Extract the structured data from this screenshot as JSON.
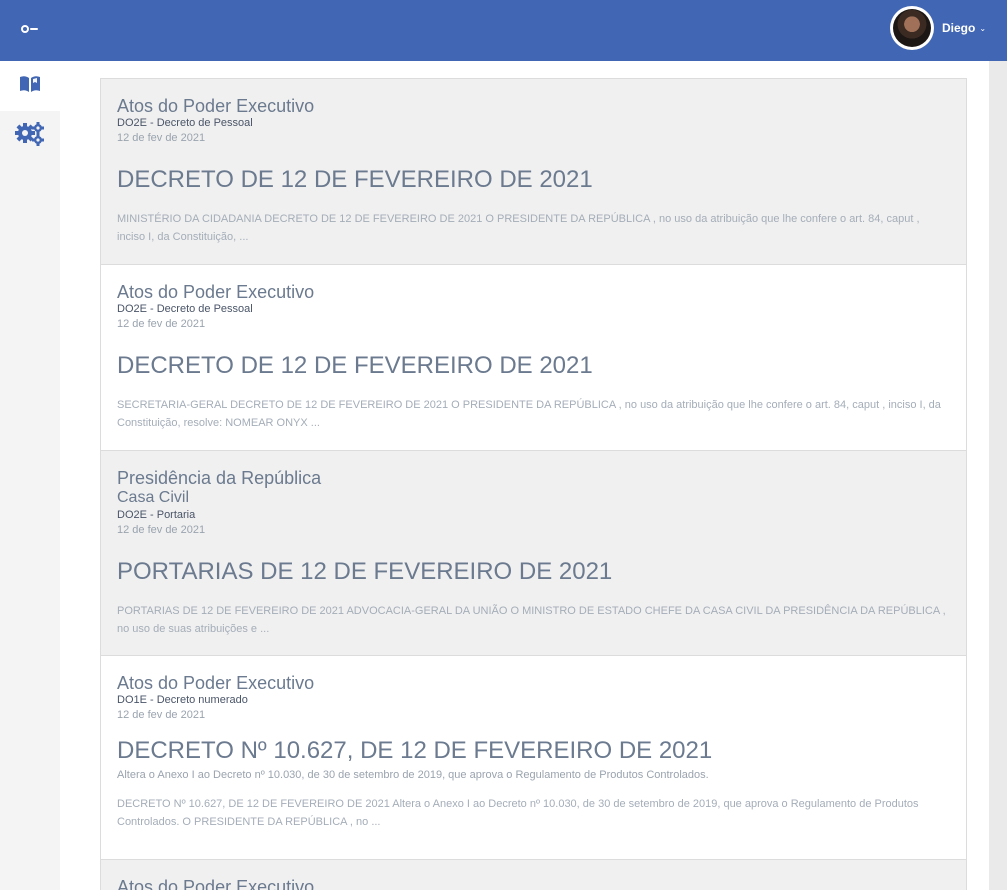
{
  "header": {
    "user_name": "Diego",
    "toggle_icon": "sidebar-toggle-icon",
    "accent_color": "#4166b3"
  },
  "sidebar": {
    "items": [
      {
        "icon": "open-book-icon",
        "active": true
      },
      {
        "icon": "gears-icon",
        "active": false
      }
    ]
  },
  "results": [
    {
      "hierarchy": [
        "Atos do Poder Executivo"
      ],
      "section": "DO2E - Decreto de Pessoal",
      "date": "12 de fev de 2021",
      "title": "DECRETO DE 12 DE FEVEREIRO DE 2021",
      "ementa": "",
      "excerpt": "MINISTÉRIO DA CIDADANIA DECRETO DE 12 DE FEVEREIRO DE 2021 O PRESIDENTE DA REPÚBLICA , no uso da atribuição que lhe confere o art. 84, caput , inciso I, da Constituição, ..."
    },
    {
      "hierarchy": [
        "Atos do Poder Executivo"
      ],
      "section": "DO2E - Decreto de Pessoal",
      "date": "12 de fev de 2021",
      "title": "DECRETO DE 12 DE FEVEREIRO DE 2021",
      "ementa": "",
      "excerpt": "SECRETARIA-GERAL DECRETO DE 12 DE FEVEREIRO DE 2021 O PRESIDENTE DA REPÚBLICA , no uso da atribuição que lhe confere o art. 84, caput , inciso I, da Constituição, resolve: NOMEAR ONYX ..."
    },
    {
      "hierarchy": [
        "Presidência da República",
        "Casa Civil"
      ],
      "section": "DO2E - Portaria",
      "date": "12 de fev de 2021",
      "title": "PORTARIAS DE 12 DE FEVEREIRO DE 2021",
      "ementa": "",
      "excerpt": "PORTARIAS DE 12 DE FEVEREIRO DE 2021 ADVOCACIA-GERAL DA UNIÃO O MINISTRO DE ESTADO CHEFE DA CASA CIVIL DA PRESIDÊNCIA DA REPÚBLICA , no uso de suas atribuições e ..."
    },
    {
      "hierarchy": [
        "Atos do Poder Executivo"
      ],
      "section": "DO1E - Decreto numerado",
      "date": "12 de fev de 2021",
      "title": "DECRETO Nº 10.627, DE 12 DE FEVEREIRO DE 2021",
      "ementa": "Altera o Anexo I ao Decreto nº 10.030, de 30 de setembro de 2019, que aprova o Regulamento de Produtos Controlados.",
      "excerpt": "DECRETO Nº 10.627, DE 12 DE FEVEREIRO DE 2021 Altera o Anexo I ao Decreto nº 10.030, de 30 de setembro de 2019, que aprova o Regulamento de Produtos Controlados. O PRESIDENTE DA REPÚBLICA , no ..."
    },
    {
      "hierarchy": [
        "Atos do Poder Executivo"
      ],
      "section": "",
      "date": "",
      "title": "",
      "ementa": "",
      "excerpt": ""
    }
  ]
}
